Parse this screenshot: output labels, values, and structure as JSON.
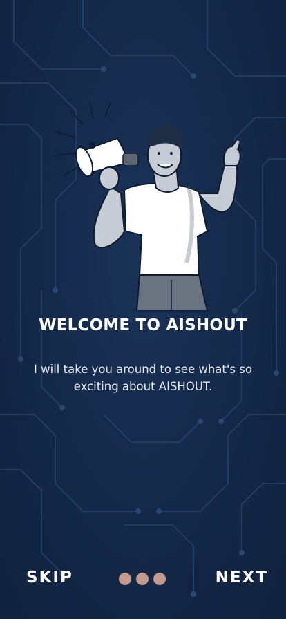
{
  "onboarding": {
    "title": "WELCOME TO AISHOUT",
    "subtitle": "I will take you around to see what's so exciting about  AISHOUT.",
    "skip_label": "SKIP",
    "next_label": "NEXT",
    "page_count": 3,
    "illustration_icon": "person-with-megaphone-icon"
  },
  "colors": {
    "background": "#142848",
    "circuit": "#2a4d78",
    "text": "#ffffff",
    "dot": "#c49a8e"
  }
}
